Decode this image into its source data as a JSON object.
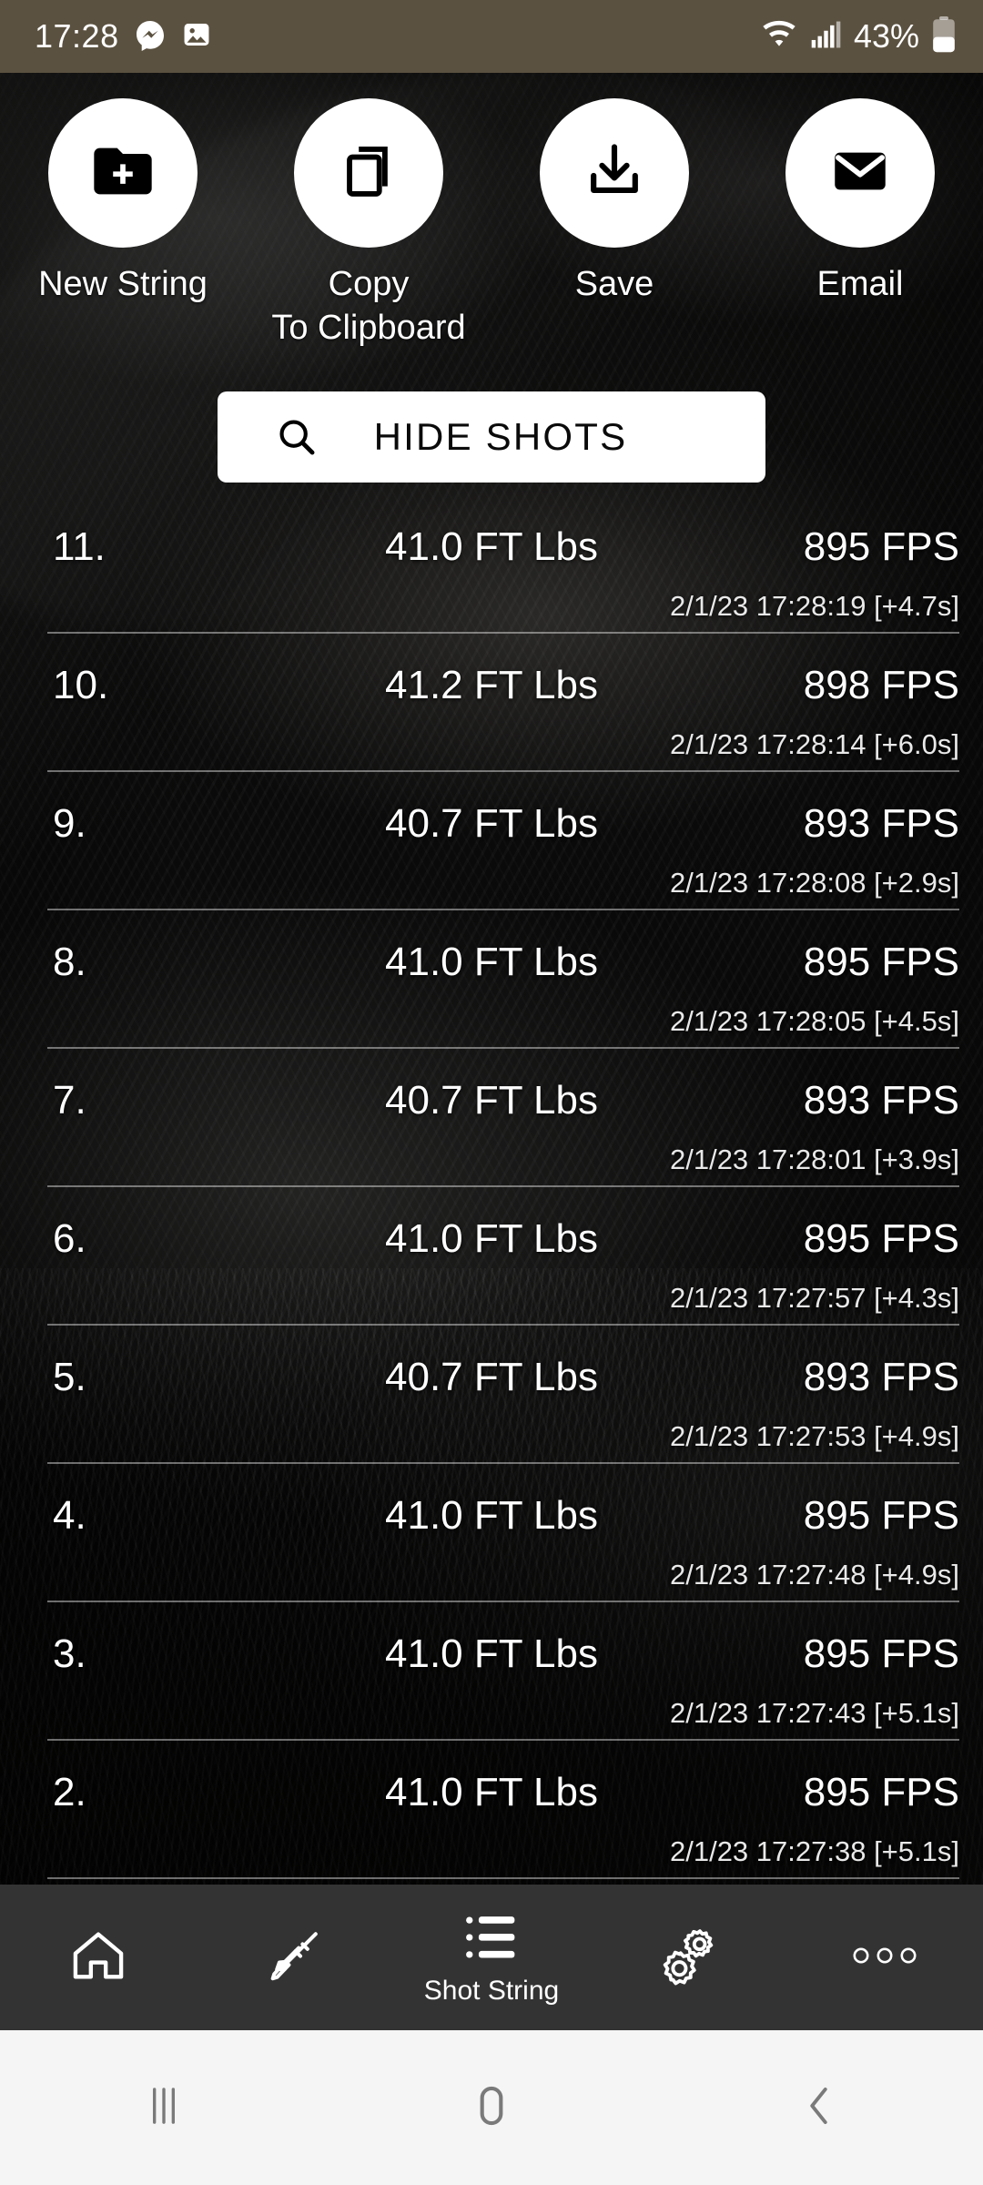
{
  "status_bar": {
    "time": "17:28",
    "battery_percent": "43%",
    "icons": [
      "messenger-icon",
      "gallery-image-icon",
      "wifi-icon",
      "cellular-signal-icon",
      "battery-icon"
    ],
    "background_color": "#5b5140"
  },
  "actions": [
    {
      "label": "New String",
      "icon": "folder-plus-icon"
    },
    {
      "label": "Copy\nTo Clipboard",
      "icon": "copy-icon"
    },
    {
      "label": "Save",
      "icon": "download-save-icon"
    },
    {
      "label": "Email",
      "icon": "envelope-icon"
    }
  ],
  "hide_shots": {
    "label": "HIDE SHOTS",
    "icon": "search-magnifier-icon"
  },
  "shot_list": {
    "columns": [
      "index",
      "energy",
      "velocity",
      "timestamp"
    ],
    "rows": [
      {
        "index": "11.",
        "energy": "41.0 FT Lbs",
        "velocity": "895 FPS",
        "timestamp": "2/1/23 17:28:19 [+4.7s]"
      },
      {
        "index": "10.",
        "energy": "41.2 FT Lbs",
        "velocity": "898 FPS",
        "timestamp": "2/1/23 17:28:14 [+6.0s]"
      },
      {
        "index": "9.",
        "energy": "40.7 FT Lbs",
        "velocity": "893 FPS",
        "timestamp": "2/1/23 17:28:08 [+2.9s]"
      },
      {
        "index": "8.",
        "energy": "41.0 FT Lbs",
        "velocity": "895 FPS",
        "timestamp": "2/1/23 17:28:05 [+4.5s]"
      },
      {
        "index": "7.",
        "energy": "40.7 FT Lbs",
        "velocity": "893 FPS",
        "timestamp": "2/1/23 17:28:01 [+3.9s]"
      },
      {
        "index": "6.",
        "energy": "41.0 FT Lbs",
        "velocity": "895 FPS",
        "timestamp": "2/1/23 17:27:57 [+4.3s]"
      },
      {
        "index": "5.",
        "energy": "40.7 FT Lbs",
        "velocity": "893 FPS",
        "timestamp": "2/1/23 17:27:53 [+4.9s]"
      },
      {
        "index": "4.",
        "energy": "41.0 FT Lbs",
        "velocity": "895 FPS",
        "timestamp": "2/1/23 17:27:48 [+4.9s]"
      },
      {
        "index": "3.",
        "energy": "41.0 FT Lbs",
        "velocity": "895 FPS",
        "timestamp": "2/1/23 17:27:43 [+5.1s]"
      },
      {
        "index": "2.",
        "energy": "41.0 FT Lbs",
        "velocity": "895 FPS",
        "timestamp": "2/1/23 17:27:38 [+5.1s]"
      }
    ]
  },
  "app_nav": {
    "background_color": "#333333",
    "items": [
      {
        "icon": "home-icon",
        "label": "",
        "active": false
      },
      {
        "icon": "rifle-icon",
        "label": "",
        "active": false
      },
      {
        "icon": "list-icon",
        "label": "Shot String",
        "active": true
      },
      {
        "icon": "gears-settings-icon",
        "label": "",
        "active": false
      },
      {
        "icon": "more-dots-icon",
        "label": "",
        "active": false
      }
    ]
  },
  "system_nav": {
    "background_color": "#f5f5f5",
    "buttons": [
      "recents-icon",
      "home-square-icon",
      "back-chevron-icon"
    ]
  }
}
